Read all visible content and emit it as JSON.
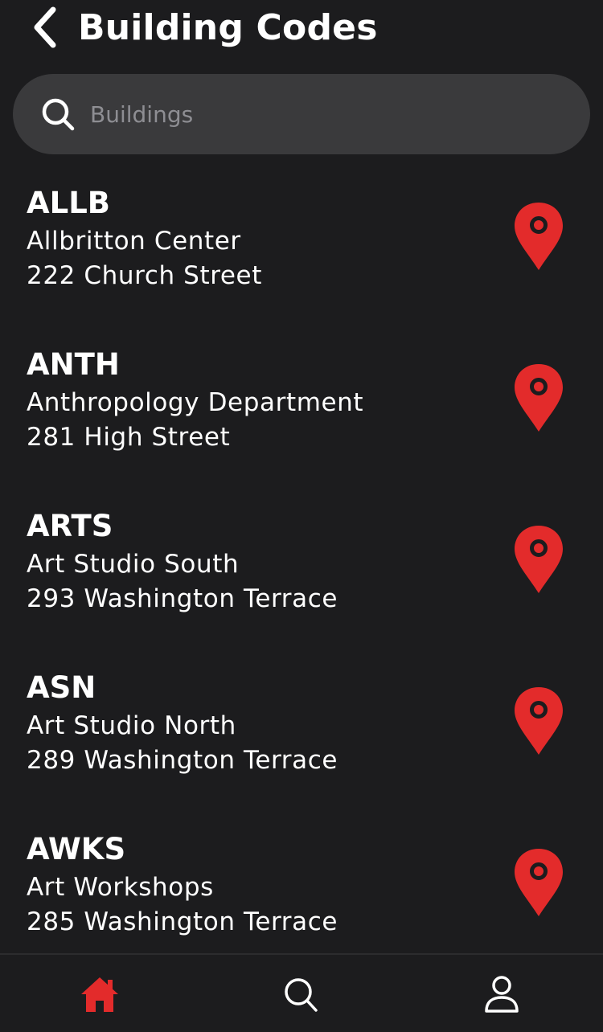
{
  "header": {
    "title": "Building Codes",
    "back_icon": "chevron-left-icon"
  },
  "search": {
    "placeholder": "Buildings",
    "value": "",
    "icon": "search-icon"
  },
  "buildings": [
    {
      "code": "ALLB",
      "name": "Allbritton Center",
      "address": "222 Church Street"
    },
    {
      "code": "ANTH",
      "name": "Anthropology Department",
      "address": "281 High Street"
    },
    {
      "code": "ARTS",
      "name": "Art Studio South",
      "address": "293 Washington Terrace"
    },
    {
      "code": "ASN",
      "name": "Art Studio North",
      "address": "289 Washington Terrace"
    },
    {
      "code": "AWKS",
      "name": "Art Workshops",
      "address": "285 Washington Terrace"
    }
  ],
  "tabbar": {
    "tabs": [
      {
        "icon": "home-icon",
        "active": true
      },
      {
        "icon": "search-icon",
        "active": false
      },
      {
        "icon": "profile-icon",
        "active": false
      }
    ]
  },
  "colors": {
    "background": "#1c1c1e",
    "search_bg": "#3a3a3c",
    "accent": "#e32b2b",
    "text": "#ffffff",
    "placeholder": "#8e8e93"
  }
}
